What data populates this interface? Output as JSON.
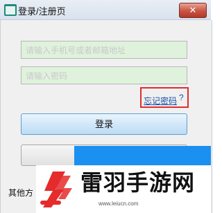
{
  "window": {
    "title": "登录/注册页",
    "close_label": "✕"
  },
  "form": {
    "phone_placeholder": "请输入手机号或者邮箱地址",
    "password_placeholder": "请输入密码",
    "forgot_label": "忘记密码",
    "help_glyph": "?",
    "login_label": "登录",
    "register_label": "",
    "other_methods_label": "其他方"
  },
  "watermark": {
    "name": "雷羽手游网",
    "url": "www.leiucn.com"
  },
  "colors": {
    "input_bg": "#dff2dc",
    "highlight_border": "#e02c2c",
    "link": "#1a4fa8",
    "watermark_blue": "#1a90f1",
    "watermark_red": "#e52b2b"
  }
}
